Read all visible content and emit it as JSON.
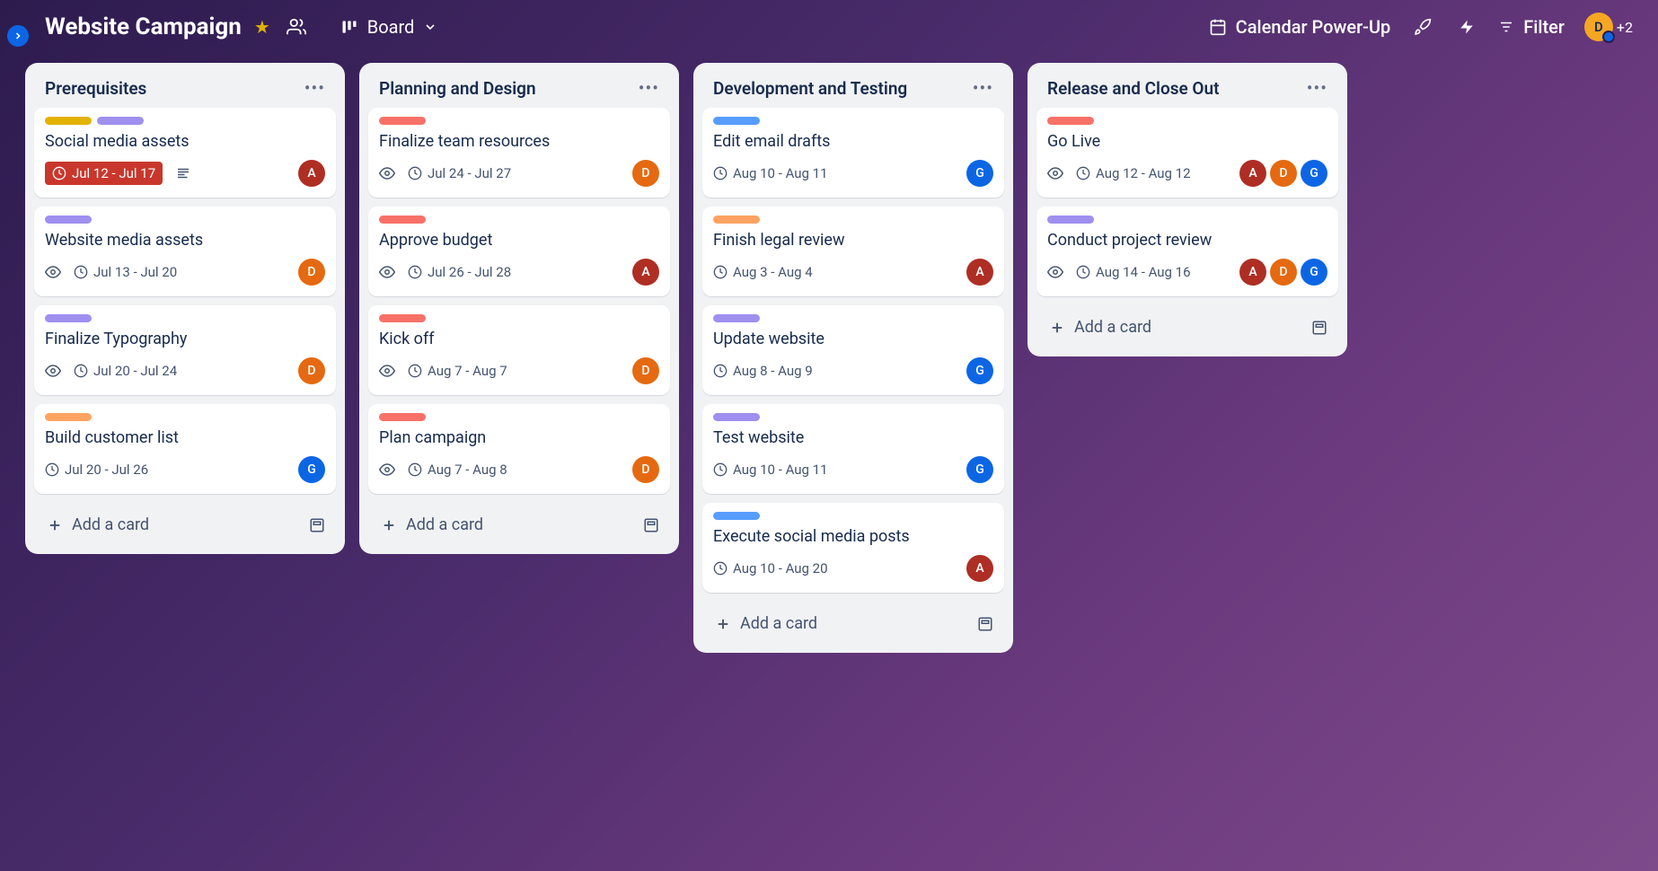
{
  "header": {
    "board_title": "Website Campaign",
    "view_label": "Board",
    "powerup_label": "Calendar Power-Up",
    "filter_label": "Filter",
    "avatar_letter": "D",
    "plus_count": "+2"
  },
  "lists": [
    {
      "title": "Prerequisites",
      "cards": [
        {
          "labels": [
            "yellow",
            "purple"
          ],
          "title": "Social media assets",
          "watch": false,
          "date": "Jul 12 - Jul 17",
          "date_overdue": true,
          "has_desc": true,
          "members": [
            "A"
          ]
        },
        {
          "labels": [
            "purple"
          ],
          "title": "Website media assets",
          "watch": true,
          "date": "Jul 13 - Jul 20",
          "date_overdue": false,
          "has_desc": false,
          "members": [
            "D"
          ]
        },
        {
          "labels": [
            "purple"
          ],
          "title": "Finalize Typography",
          "watch": true,
          "date": "Jul 20 - Jul 24",
          "date_overdue": false,
          "has_desc": false,
          "members": [
            "D"
          ]
        },
        {
          "labels": [
            "orange"
          ],
          "title": "Build customer list",
          "watch": false,
          "date": "Jul 20 - Jul 26",
          "date_overdue": false,
          "has_desc": false,
          "members": [
            "G"
          ]
        }
      ]
    },
    {
      "title": "Planning and Design",
      "cards": [
        {
          "labels": [
            "red"
          ],
          "title": "Finalize team resources",
          "watch": true,
          "date": "Jul 24 - Jul 27",
          "date_overdue": false,
          "has_desc": false,
          "members": [
            "D"
          ]
        },
        {
          "labels": [
            "red"
          ],
          "title": "Approve budget",
          "watch": true,
          "date": "Jul 26 - Jul 28",
          "date_overdue": false,
          "has_desc": false,
          "members": [
            "A"
          ]
        },
        {
          "labels": [
            "red"
          ],
          "title": "Kick off",
          "watch": true,
          "date": "Aug 7 - Aug 7",
          "date_overdue": false,
          "has_desc": false,
          "members": [
            "D"
          ]
        },
        {
          "labels": [
            "red"
          ],
          "title": "Plan campaign",
          "watch": true,
          "date": "Aug 7 - Aug 8",
          "date_overdue": false,
          "has_desc": false,
          "members": [
            "D"
          ]
        }
      ]
    },
    {
      "title": "Development and Testing",
      "cards": [
        {
          "labels": [
            "blue"
          ],
          "title": "Edit email drafts",
          "watch": false,
          "date": "Aug 10 - Aug 11",
          "date_overdue": false,
          "has_desc": false,
          "members": [
            "G"
          ]
        },
        {
          "labels": [
            "orange"
          ],
          "title": "Finish legal review",
          "watch": false,
          "date": "Aug 3 - Aug 4",
          "date_overdue": false,
          "has_desc": false,
          "members": [
            "A"
          ]
        },
        {
          "labels": [
            "purple"
          ],
          "title": "Update website",
          "watch": false,
          "date": "Aug 8 - Aug 9",
          "date_overdue": false,
          "has_desc": false,
          "members": [
            "G"
          ]
        },
        {
          "labels": [
            "purple"
          ],
          "title": "Test website",
          "watch": false,
          "date": "Aug 10 - Aug 11",
          "date_overdue": false,
          "has_desc": false,
          "members": [
            "G"
          ]
        },
        {
          "labels": [
            "blue"
          ],
          "title": "Execute social media posts",
          "watch": false,
          "date": "Aug 10 - Aug 20",
          "date_overdue": false,
          "has_desc": false,
          "members": [
            "A"
          ]
        }
      ]
    },
    {
      "title": "Release and Close Out",
      "cards": [
        {
          "labels": [
            "red"
          ],
          "title": "Go Live",
          "watch": true,
          "date": "Aug 12 - Aug 12",
          "date_overdue": false,
          "has_desc": false,
          "members": [
            "A",
            "D",
            "G"
          ]
        },
        {
          "labels": [
            "purple"
          ],
          "title": "Conduct project review",
          "watch": true,
          "date": "Aug 14 - Aug 16",
          "date_overdue": false,
          "has_desc": false,
          "members": [
            "A",
            "D",
            "G"
          ]
        }
      ]
    }
  ],
  "add_card_label": "Add a card"
}
